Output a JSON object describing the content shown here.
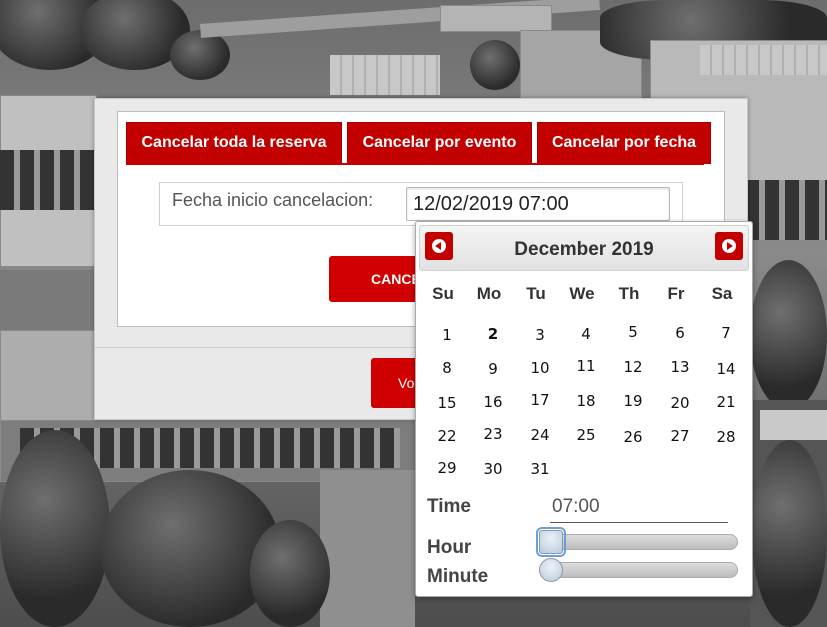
{
  "tabs": [
    {
      "label": "Cancelar toda la reserva"
    },
    {
      "label": "Cancelar por evento"
    },
    {
      "label": "Cancelar por fecha"
    }
  ],
  "form": {
    "date_label": "Fecha inicio cancelacion:",
    "date_value": "12/02/2019 07:00",
    "cancel_button": "CANCE",
    "back_button": "Vo"
  },
  "datepicker": {
    "month_title": "December 2019",
    "weekdays": [
      "Su",
      "Mo",
      "Tu",
      "We",
      "Th",
      "Fr",
      "Sa"
    ],
    "weeks": [
      [
        "",
        "",
        "",
        "",
        "",
        "",
        ""
      ],
      [
        "1",
        "2",
        "3",
        "4",
        "5",
        "6",
        "7"
      ],
      [
        "8",
        "9",
        "10",
        "11",
        "12",
        "13",
        "14"
      ],
      [
        "15",
        "16",
        "17",
        "18",
        "19",
        "20",
        "21"
      ],
      [
        "22",
        "23",
        "24",
        "25",
        "26",
        "27",
        "28"
      ],
      [
        "29",
        "30",
        "31",
        "",
        "",
        "",
        ""
      ]
    ],
    "selected_day": "2",
    "time_label": "Time",
    "time_value": "07:00",
    "hour_label": "Hour",
    "minute_label": "Minute",
    "hour_level": 0,
    "minute_level": 0
  },
  "colors": {
    "accent": "#c30000",
    "panel_bg": "#e9e9e9"
  }
}
